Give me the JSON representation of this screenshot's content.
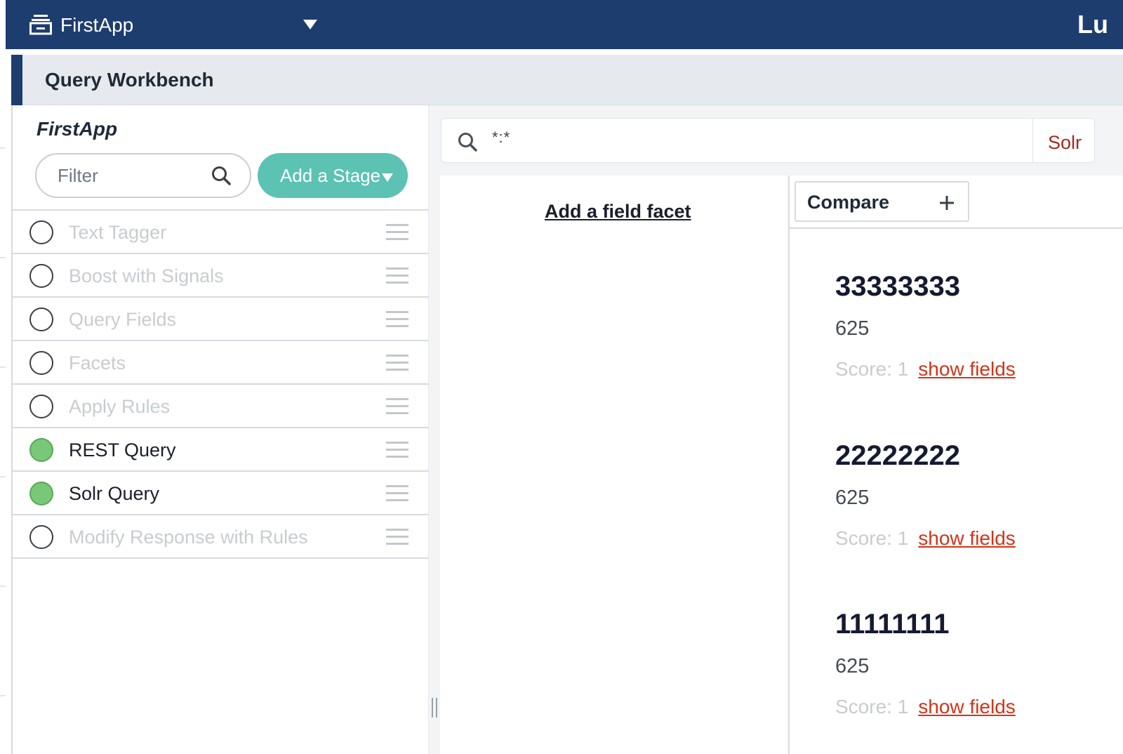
{
  "topbar": {
    "app_name": "FirstApp",
    "brand": "Lu"
  },
  "workbench": {
    "title": "Query Workbench"
  },
  "pipeline": {
    "name": "FirstApp",
    "filter_placeholder": "Filter",
    "add_stage_label": "Add a Stage",
    "stages": [
      {
        "label": "Text Tagger",
        "enabled": false
      },
      {
        "label": "Boost with Signals",
        "enabled": false
      },
      {
        "label": "Query Fields",
        "enabled": false
      },
      {
        "label": "Facets",
        "enabled": false
      },
      {
        "label": "Apply Rules",
        "enabled": false
      },
      {
        "label": "REST Query",
        "enabled": true
      },
      {
        "label": "Solr Query",
        "enabled": true
      },
      {
        "label": "Modify Response with Rules",
        "enabled": false
      }
    ]
  },
  "search": {
    "query": "*:*",
    "mode": "Solr"
  },
  "facets": {
    "add_label": "Add a field facet"
  },
  "results": {
    "compare_label": "Compare",
    "items": [
      {
        "title": "33333333",
        "subtitle": "625",
        "score": "Score: 1",
        "link": "show fields"
      },
      {
        "title": "22222222",
        "subtitle": "625",
        "score": "Score: 1",
        "link": "show fields"
      },
      {
        "title": "11111111",
        "subtitle": "625",
        "score": "Score: 1",
        "link": "show fields"
      }
    ]
  },
  "colors": {
    "nav_bg": "#1e3d6f",
    "accent_teal": "#5bc2b4",
    "stage_on": "#79c878",
    "link_red": "#d33418",
    "mode_red": "#a8281f"
  }
}
